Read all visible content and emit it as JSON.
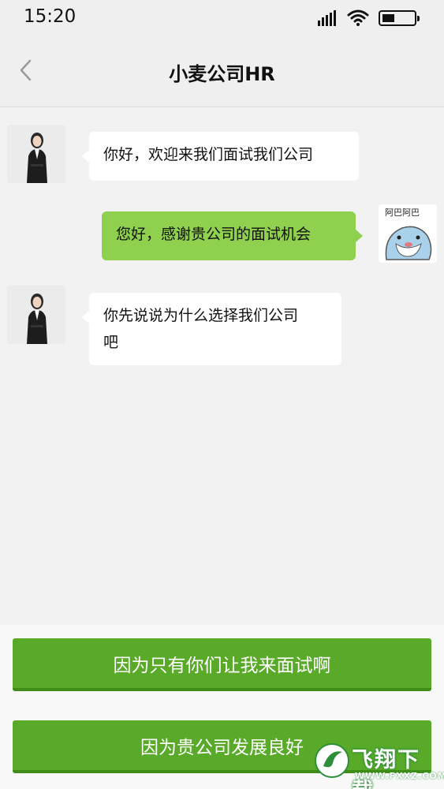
{
  "status_bar": {
    "time": "15:20"
  },
  "nav": {
    "title": "小麦公司HR"
  },
  "messages": [
    {
      "side": "left",
      "text": "你好，欢迎来我们面试我们公司"
    },
    {
      "side": "right",
      "text": "您好，感谢贵公司的面试机会"
    },
    {
      "side": "left",
      "text_line1": "你先说说为什么选择我们公司",
      "text_line2": "吧"
    }
  ],
  "sticker": {
    "caption": "阿巴阿巴"
  },
  "choices": [
    {
      "label": "因为只有你们让我来面试啊"
    },
    {
      "label": "因为贵公司发展良好"
    }
  ],
  "watermark": {
    "brand": "飞翔下载",
    "url": "WWW.FXXZ.COM"
  },
  "colors": {
    "bubble_me": "#8fd14f",
    "bubble_other": "#ffffff",
    "choice_button": "#5aaa2a",
    "background": "#f2f2f2"
  }
}
